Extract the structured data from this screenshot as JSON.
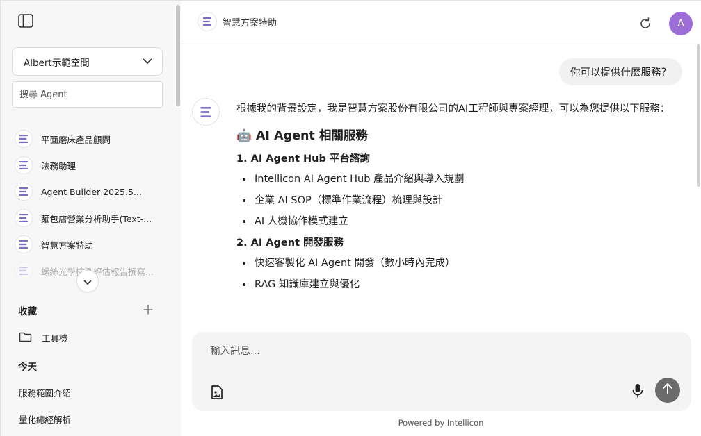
{
  "sidebar": {
    "workspace": "Albert示範空間",
    "search_placeholder": "搜尋 Agent",
    "agents": [
      {
        "label": "平面磨床產品顧問"
      },
      {
        "label": "法務助理"
      },
      {
        "label": "Agent Builder 2025.5..."
      },
      {
        "label": "麵包店營業分析助手(Text-..."
      },
      {
        "label": "智慧方案特助"
      },
      {
        "label": "螺絲光學檢測評估報告撰寫..."
      }
    ],
    "favorites_title": "收藏",
    "favorites": [
      {
        "label": "工具機"
      }
    ],
    "today_title": "今天",
    "history": [
      {
        "label": "服務範圍介紹"
      },
      {
        "label": "量化總經解析"
      }
    ]
  },
  "header": {
    "agent_name": "智慧方案特助",
    "avatar_letter": "A"
  },
  "chat": {
    "user_message": "你可以提供什麼服務？",
    "bot_intro": "根據我的背景設定，我是智慧方案股份有限公司的AI工程師與專案經理，可以為您提供以下服務：",
    "section_title": "🤖 AI Agent 相關服務",
    "subsections": [
      {
        "title": "1. AI Agent Hub 平台諮詢",
        "items": [
          "Intellicon AI Agent Hub 產品介紹與導入規劃",
          "企業 AI SOP（標準作業流程）梳理與設計",
          "AI 人機協作模式建立"
        ]
      },
      {
        "title": "2. AI Agent 開發服務",
        "items": [
          "快速客製化 AI Agent 開發（數小時內完成）",
          "RAG 知識庫建立與優化"
        ]
      }
    ]
  },
  "composer": {
    "placeholder": "輸入訊息..."
  },
  "footer": "Powered by Intellicon",
  "colors": {
    "avatar": "#9d6ed8",
    "logo_accent": "#7b6cc4",
    "send_button": "#6b6b6b"
  }
}
